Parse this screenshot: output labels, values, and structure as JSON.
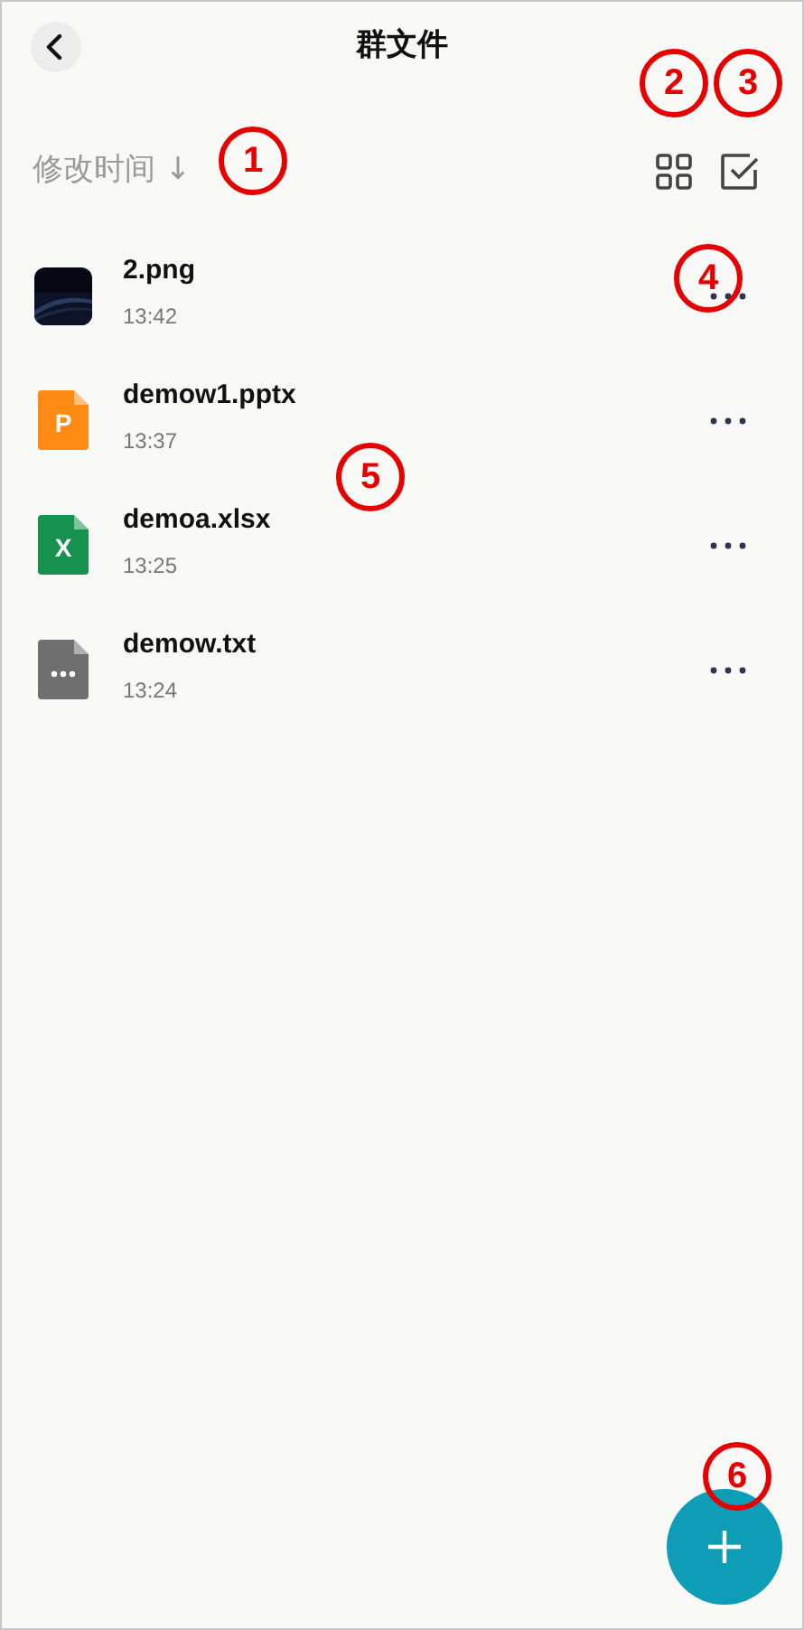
{
  "header": {
    "title": "群文件"
  },
  "toolbar": {
    "sort_label": "修改时间 ↓"
  },
  "files": [
    {
      "name": "2.png",
      "time": "13:42"
    },
    {
      "kind": "pptx",
      "icon_text": "P",
      "name": "demow1.pptx",
      "time": "13:37"
    },
    {
      "kind": "xlsx",
      "icon_text": "X",
      "name": "demoa.xlsx",
      "time": "13:25"
    },
    {
      "kind": "txt",
      "name": "demow.txt",
      "time": "13:24"
    }
  ],
  "annotations": [
    {
      "label": "1"
    },
    {
      "label": "2"
    },
    {
      "label": "3"
    },
    {
      "label": "4"
    },
    {
      "label": "5"
    },
    {
      "label": "6"
    }
  ]
}
